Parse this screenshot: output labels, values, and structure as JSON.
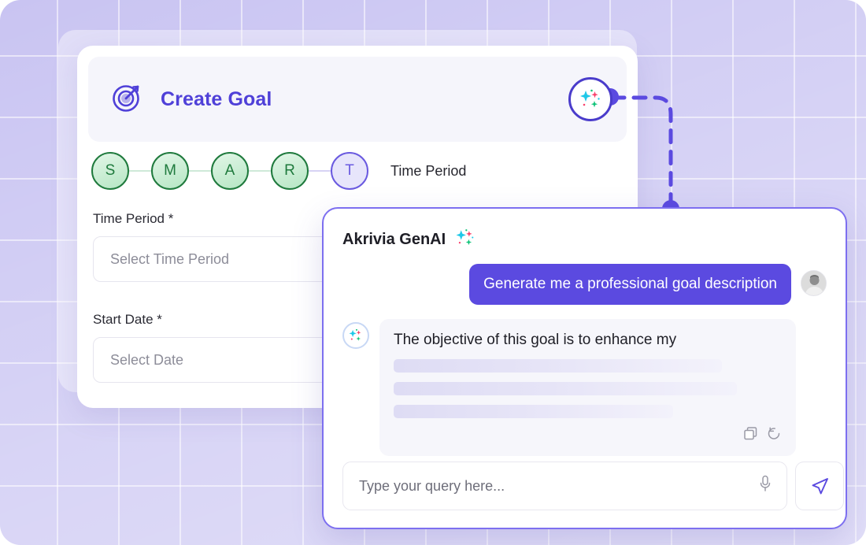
{
  "theme": {
    "background": "#c9c4f2",
    "accent": "#5b4ae0",
    "accent_dark": "#4a3ccb",
    "title_purple": "#4f40d8",
    "step_done_green": "#1f7a3d",
    "panel_border": "#7d6ff0"
  },
  "goal_card": {
    "icon": "target-icon",
    "title": "Create Goal",
    "ai_badge_icon": "sparkle-icon"
  },
  "stepper": {
    "steps": [
      {
        "letter": "S",
        "state": "done"
      },
      {
        "letter": "M",
        "state": "done"
      },
      {
        "letter": "A",
        "state": "done"
      },
      {
        "letter": "R",
        "state": "done"
      },
      {
        "letter": "T",
        "state": "current"
      }
    ],
    "current_label": "Time Period"
  },
  "form": {
    "fields": [
      {
        "label": "Time Period *",
        "placeholder": "Select Time Period",
        "value": "",
        "chevron": "chevron-down-icon"
      },
      {
        "label": "Start Date *",
        "placeholder": "Select Date",
        "value": "",
        "chevron": "chevron-down-icon"
      }
    ]
  },
  "chat": {
    "title": "Akrivia GenAI",
    "title_icon": "sparkle-icon",
    "messages": [
      {
        "role": "user",
        "text": "Generate me a professional goal description",
        "avatar": "user-avatar"
      },
      {
        "role": "assistant",
        "text": "The objective of this goal is to enhance my",
        "avatar": "sparkle-icon",
        "loading_lines": 3,
        "actions": [
          {
            "name": "copy-icon",
            "label": "Copy"
          },
          {
            "name": "regenerate-icon",
            "label": "Regenerate"
          }
        ]
      }
    ],
    "input": {
      "placeholder": "Type your query here...",
      "value": "",
      "mic_icon": "microphone-icon",
      "send_icon": "send-icon"
    }
  }
}
